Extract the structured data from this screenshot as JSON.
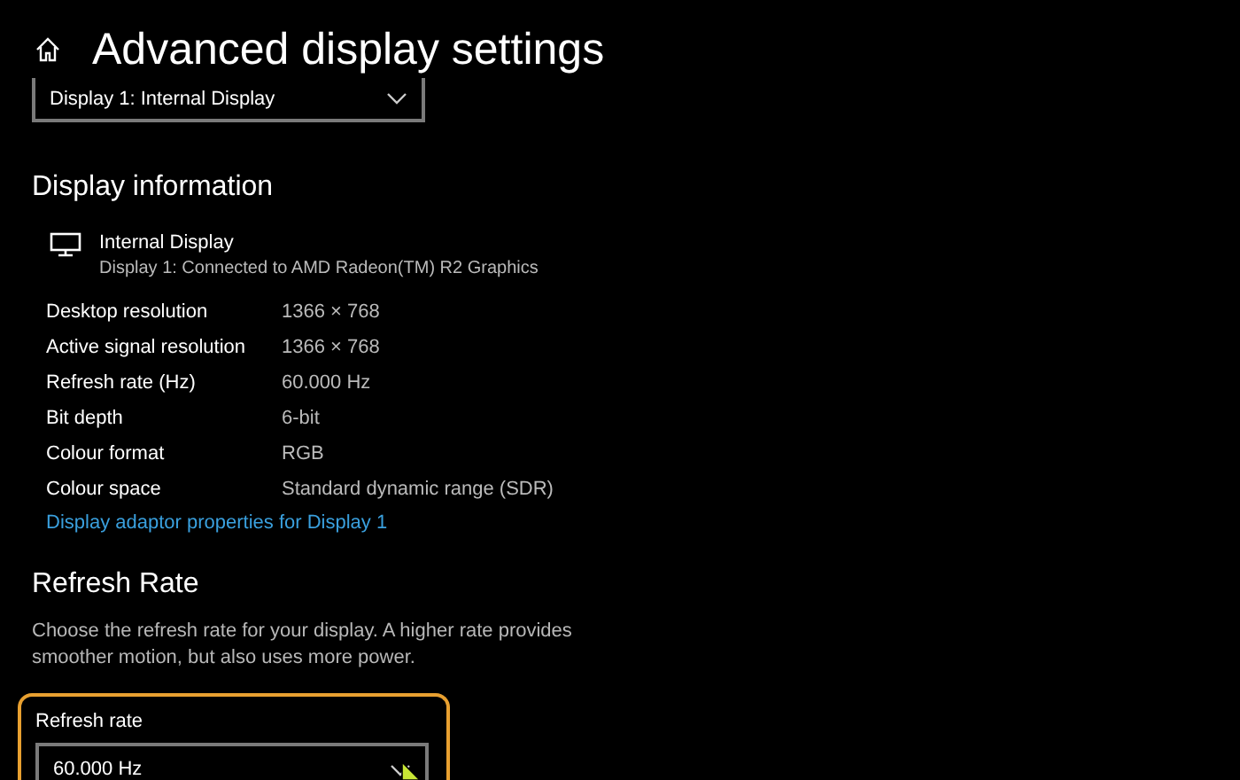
{
  "header": {
    "title": "Advanced display settings"
  },
  "display_select": {
    "value": "Display 1: Internal Display"
  },
  "display_information": {
    "heading": "Display information",
    "display_name": "Internal Display",
    "display_detail": "Display 1: Connected to AMD Radeon(TM) R2 Graphics",
    "rows": [
      {
        "label": "Desktop resolution",
        "value": "1366 × 768"
      },
      {
        "label": "Active signal resolution",
        "value": "1366 × 768"
      },
      {
        "label": "Refresh rate (Hz)",
        "value": "60.000 Hz"
      },
      {
        "label": "Bit depth",
        "value": "6-bit"
      },
      {
        "label": "Colour format",
        "value": "RGB"
      },
      {
        "label": "Colour space",
        "value": "Standard dynamic range (SDR)"
      }
    ],
    "link": "Display adaptor properties for Display 1"
  },
  "refresh_rate": {
    "heading": "Refresh Rate",
    "description": "Choose the refresh rate for your display. A higher rate provides smoother motion, but also uses more power.",
    "field_label": "Refresh rate",
    "value": "60.000 Hz",
    "highlighted": true
  }
}
